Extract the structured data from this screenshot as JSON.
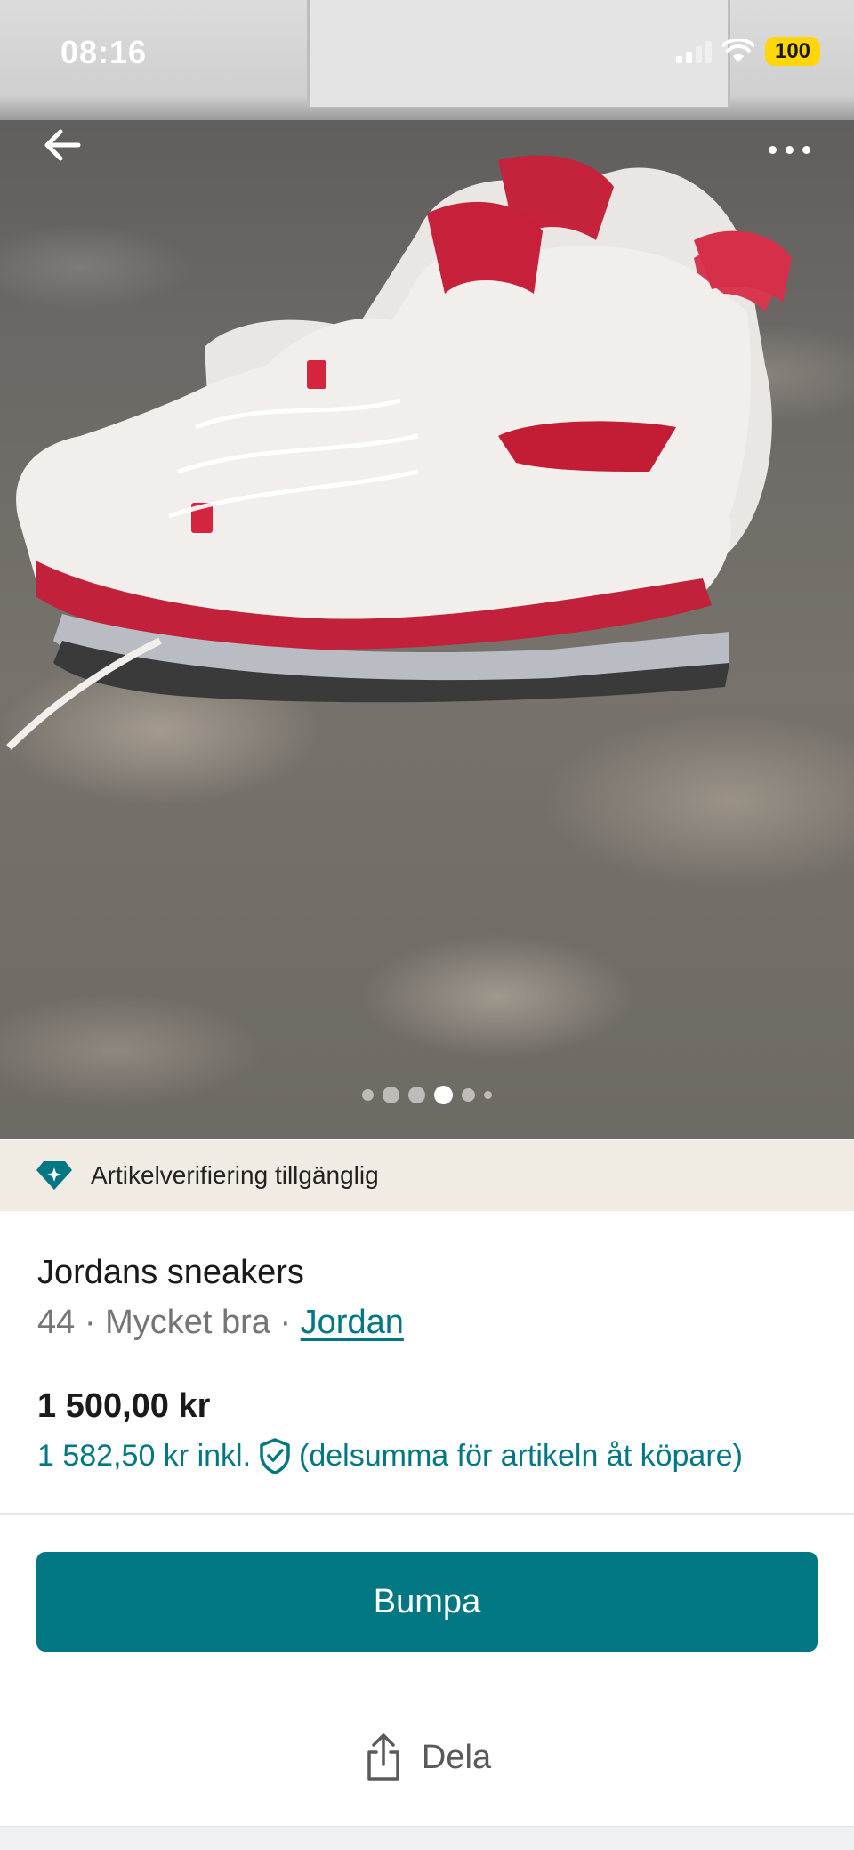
{
  "status_bar": {
    "time": "08:16",
    "battery": "100",
    "battery_color": "#ffd60a"
  },
  "gallery": {
    "image_count": 6,
    "current_index": 4
  },
  "verification_banner": {
    "text": "Artikelverifiering tillgänglig",
    "icon": "diamond-icon"
  },
  "item": {
    "title": "Jordans sneakers",
    "size": "44",
    "condition": "Mycket bra",
    "brand": "Jordan",
    "separator": " · ",
    "price": "1 500,00 kr",
    "price_incl": "1 582,50 kr inkl.",
    "price_incl_note": "(delsumma för artikeln åt köpare)"
  },
  "actions": {
    "bump_label": "Bumpa",
    "share_label": "Dela"
  },
  "colors": {
    "accent": "#007782",
    "banner_bg": "#f1ece3"
  }
}
